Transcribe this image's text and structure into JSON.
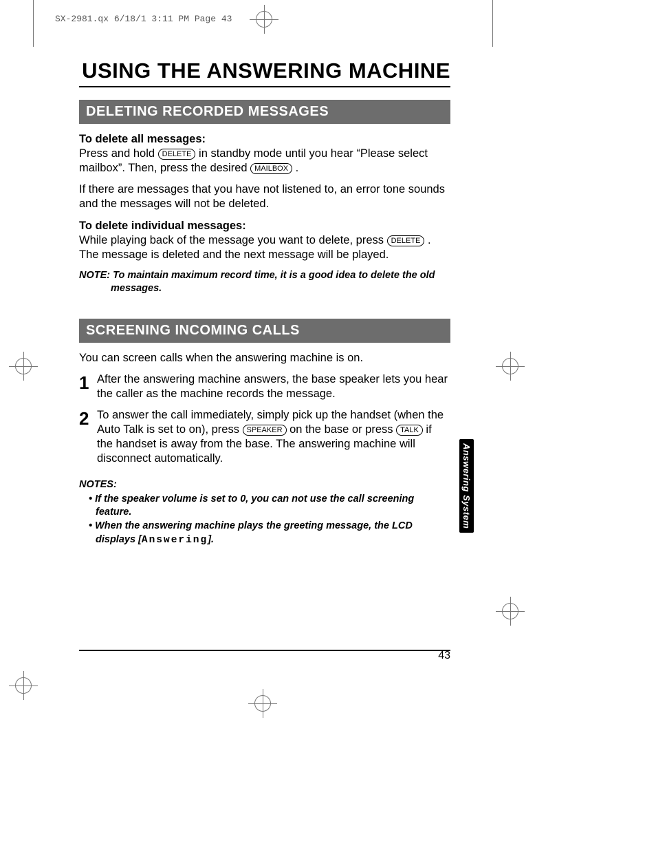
{
  "slug": "SX-2981.qx  6/18/1 3:11 PM  Page 43",
  "title": "USING THE ANSWERING MACHINE",
  "sections": {
    "deleting": {
      "heading": "DELETING RECORDED MESSAGES",
      "sub1": "To delete all messages:",
      "p1a": "Press and hold ",
      "key1": "DELETE",
      "p1b": " in standby mode until you hear “Please select mailbox”. Then, press the desired ",
      "key2": "MAILBOX",
      "p1c": ".",
      "p2": "If there are messages that you have not listened to, an error tone sounds and the messages will not be deleted.",
      "sub2": "To delete individual messages:",
      "p3a": "While playing back of the message you want to delete, press ",
      "key3": "DELETE",
      "p3b": ". The message is deleted and the next message will be played.",
      "note": "NOTE: To maintain maximum record time, it is a good idea to delete the old messages."
    },
    "screening": {
      "heading": "SCREENING INCOMING CALLS",
      "intro": "You can screen calls when the answering machine is on.",
      "step1": "After the answering machine answers, the base speaker lets you hear the caller as the machine records the message.",
      "step2a": "To answer the call immediately, simply pick up the handset (when the Auto Talk is set to on), press ",
      "keySpeaker": "SPEAKER",
      "step2b": " on the base or press ",
      "keyTalk": "TALK",
      "step2c": " if the handset is away from the base.  The answering machine will disconnect automatically.",
      "notesHead": "NOTES:",
      "note1": "If the speaker volume is set to 0, you can not use the call screening feature.",
      "note2a": "When the answering machine plays the greeting message, the LCD displays [",
      "note2mono": "Answering",
      "note2b": "]."
    }
  },
  "sideTab": "Answering System",
  "pageNumber": "43"
}
